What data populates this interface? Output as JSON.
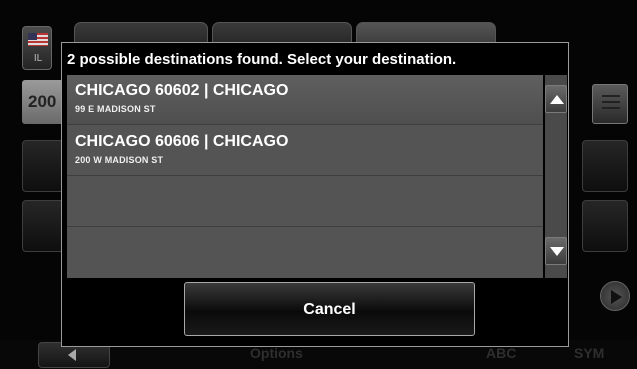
{
  "background": {
    "flag": {
      "state": "IL"
    },
    "entry": {
      "text": "200"
    },
    "bottom_bar": {
      "options_label": "Options",
      "abc_label": "ABC",
      "sym_label": "SYM"
    }
  },
  "dialog": {
    "title": "2 possible destinations found. Select your destination.",
    "results": [
      {
        "main": "CHICAGO 60602  | CHICAGO",
        "sub": "99 E MADISON ST"
      },
      {
        "main": "CHICAGO 60606  | CHICAGO",
        "sub": "200 W MADISON ST"
      },
      {
        "main": "",
        "sub": ""
      },
      {
        "main": "",
        "sub": ""
      }
    ],
    "cancel_label": "Cancel"
  },
  "icons": {
    "flag": "us-flag-icon",
    "list": "list-view-icon",
    "next": "arrow-right-icon",
    "back": "arrow-left-icon",
    "scroll_up": "triangle-up-icon",
    "scroll_down": "triangle-down-icon"
  },
  "colors": {
    "dialog_bg": "#000000",
    "list_bg": "#545454",
    "dialog_border": "#9a9a9a"
  }
}
